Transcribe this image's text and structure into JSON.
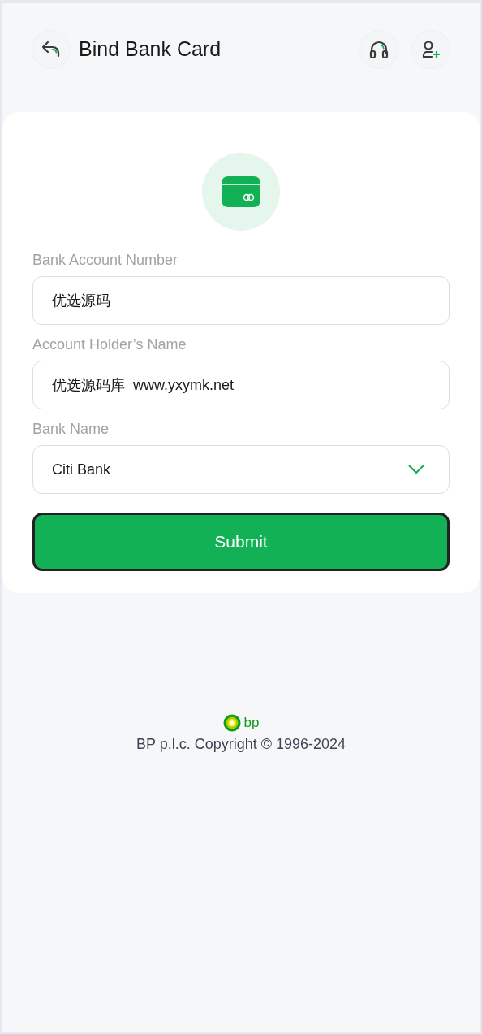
{
  "header": {
    "title": "Bind Bank Card"
  },
  "form": {
    "fields": [
      {
        "kind": "input",
        "label": "Bank Account Number",
        "value": "优选源码"
      },
      {
        "kind": "input",
        "label": "Account Holder’s Name",
        "value": "优选源码库  www.yxymk.net"
      },
      {
        "kind": "select",
        "label": "Bank Name",
        "value": "Citi Bank"
      }
    ],
    "submit": "Submit"
  },
  "footer": {
    "logo_text": "bp",
    "copyright": "BP p.l.c. Copyright © 1996-2024"
  }
}
